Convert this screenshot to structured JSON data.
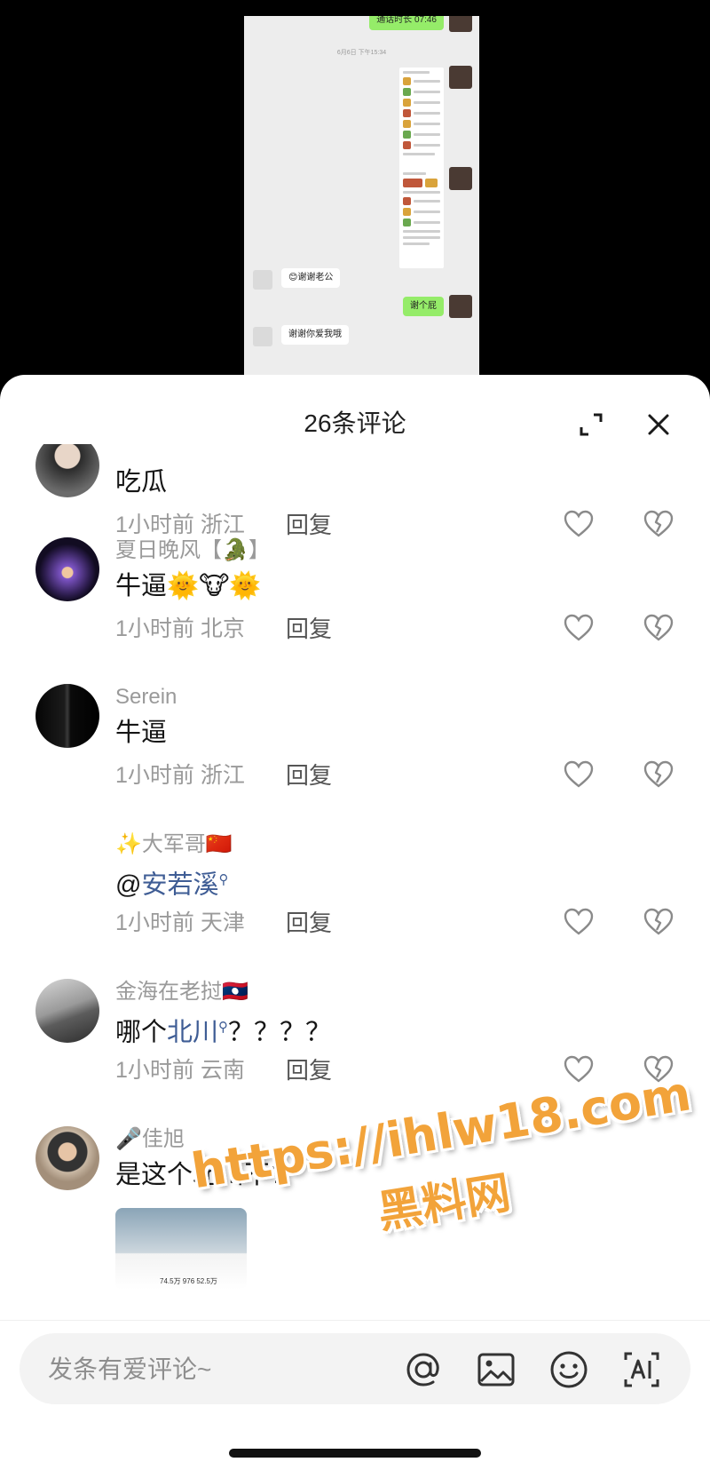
{
  "video": {
    "chat_top_bubble": "通话时长 07:46",
    "chat_time": "6月6日 下午15:34",
    "messages": [
      {
        "side": "left",
        "text": "😊谢谢老公"
      },
      {
        "side": "right",
        "text": "谢个屁"
      },
      {
        "side": "left",
        "text": "谢谢你爱我哦"
      }
    ]
  },
  "sheet": {
    "title": "26条评论"
  },
  "comments": [
    {
      "name": "",
      "text": "吃瓜",
      "time": "1小时前",
      "location": "浙江",
      "reply": "回复"
    },
    {
      "name": "夏日晚风【🐊】",
      "text": "牛逼🌞🐮🌞",
      "time": "1小时前",
      "location": "北京",
      "reply": "回复"
    },
    {
      "name": "Serein",
      "text": "牛逼",
      "time": "1小时前",
      "location": "浙江",
      "reply": "回复"
    },
    {
      "name": "✨大军哥🇨🇳",
      "text_prefix": "@",
      "mention": "安若溪",
      "time": "1小时前",
      "location": "天津",
      "reply": "回复"
    },
    {
      "name": "金海在老挝🇱🇦",
      "text_prefix": "哪个",
      "mention": "北川",
      "text_suffix": "？？？？",
      "time": "1小时前",
      "location": "云南",
      "reply": "回复"
    },
    {
      "name": "🎤佳旭",
      "text": "是这个北川不?",
      "video_stats": "74.5万   976   52.5万"
    }
  ],
  "input": {
    "placeholder": "发条有爱评论~"
  },
  "watermark": {
    "url": "https://ihlw18.com",
    "name": "黑料网"
  },
  "colors": {
    "mention": "#3f5d95",
    "bubble_green": "#95ec69",
    "watermark": "#f2a33a"
  },
  "icons": [
    "expand-icon",
    "close-icon",
    "heart-icon",
    "broken-heart-icon",
    "at-icon",
    "image-icon",
    "emoji-icon",
    "ai-icon"
  ]
}
